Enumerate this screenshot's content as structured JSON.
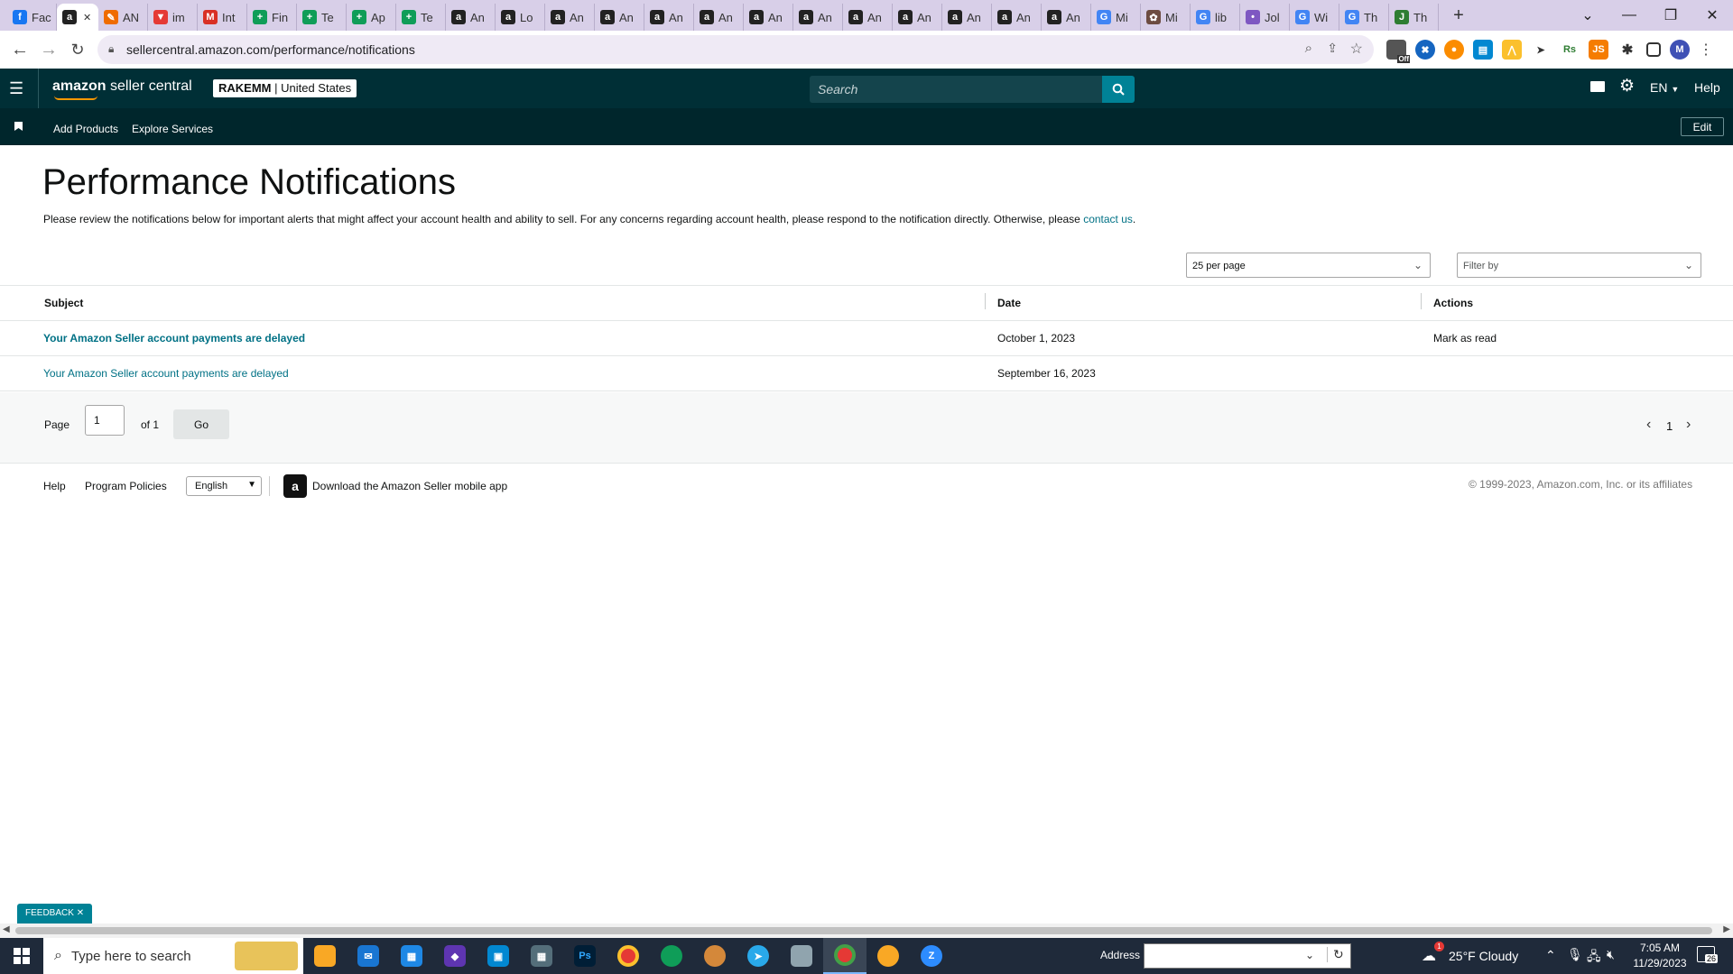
{
  "browser": {
    "tabs": [
      {
        "label": "Fac",
        "fav": "f",
        "color": "#1877f2"
      },
      {
        "label": "",
        "fav": "a",
        "color": "#222",
        "active": true
      },
      {
        "label": "AN",
        "fav": "✎",
        "color": "#ef6c00"
      },
      {
        "label": "im",
        "fav": "▼",
        "color": "#e53935"
      },
      {
        "label": "Int",
        "fav": "M",
        "color": "#d93025"
      },
      {
        "label": "Fin",
        "fav": "+",
        "color": "#0f9d58"
      },
      {
        "label": "Te",
        "fav": "+",
        "color": "#0f9d58"
      },
      {
        "label": "Ap",
        "fav": "+",
        "color": "#0f9d58"
      },
      {
        "label": "Te",
        "fav": "+",
        "color": "#0f9d58"
      },
      {
        "label": "An",
        "fav": "a",
        "color": "#222"
      },
      {
        "label": "Lo",
        "fav": "a",
        "color": "#222"
      },
      {
        "label": "An",
        "fav": "a",
        "color": "#222"
      },
      {
        "label": "An",
        "fav": "a",
        "color": "#222"
      },
      {
        "label": "An",
        "fav": "a",
        "color": "#222"
      },
      {
        "label": "An",
        "fav": "a",
        "color": "#222"
      },
      {
        "label": "An",
        "fav": "a",
        "color": "#222"
      },
      {
        "label": "An",
        "fav": "a",
        "color": "#222"
      },
      {
        "label": "An",
        "fav": "a",
        "color": "#222"
      },
      {
        "label": "An",
        "fav": "a",
        "color": "#222"
      },
      {
        "label": "An",
        "fav": "a",
        "color": "#222"
      },
      {
        "label": "An",
        "fav": "a",
        "color": "#222"
      },
      {
        "label": "An",
        "fav": "a",
        "color": "#222"
      },
      {
        "label": "Mi",
        "fav": "G",
        "color": "#4285f4"
      },
      {
        "label": "Mi",
        "fav": "✿",
        "color": "#6d4c41"
      },
      {
        "label": "lib",
        "fav": "G",
        "color": "#4285f4"
      },
      {
        "label": "Jol",
        "fav": "•",
        "color": "#7e57c2"
      },
      {
        "label": "Wi",
        "fav": "G",
        "color": "#4285f4"
      },
      {
        "label": "Th",
        "fav": "G",
        "color": "#4285f4"
      },
      {
        "label": "Th",
        "fav": "J",
        "color": "#2e7d32"
      }
    ],
    "new_tab": "+",
    "url": "sellercentral.amazon.com/performance/notifications",
    "profile_initial": "M",
    "ext_badge": "Off"
  },
  "header": {
    "logo_amazon": "amazon",
    "logo_rest": " seller central",
    "account_name": "RAKEMM",
    "account_region": " | United States",
    "search_placeholder": "Search",
    "lang": "EN",
    "help": "Help"
  },
  "subnav": {
    "items": [
      "Add Products",
      "Explore Services"
    ],
    "edit": "Edit"
  },
  "page": {
    "title": "Performance Notifications",
    "desc": "Please review the notifications below for important alerts that might affect your account health and ability to sell. For any concerns regarding account health, please respond to the notification directly. Otherwise, please ",
    "desc_link": "contact us",
    "desc_end": ".",
    "per_page": "25 per page",
    "filter": "Filter by"
  },
  "table": {
    "headers": {
      "subject": "Subject",
      "date": "Date",
      "actions": "Actions"
    },
    "rows": [
      {
        "subject": "Your Amazon Seller account payments are delayed",
        "date": "October 1, 2023",
        "action": "Mark as read",
        "unread": true
      },
      {
        "subject": "Your Amazon Seller account payments are delayed",
        "date": "September 16, 2023",
        "action": "",
        "unread": false
      }
    ]
  },
  "pagination": {
    "page_label": "Page",
    "page_value": "1",
    "of_label": "of 1",
    "go": "Go",
    "current": "1"
  },
  "footer": {
    "help": "Help",
    "policies": "Program Policies",
    "language": "English",
    "app": "Download the Amazon Seller mobile app",
    "copyright": "© 1999-2023, Amazon.com, Inc. or its affiliates"
  },
  "feedback": "FEEDBACK",
  "taskbar": {
    "search_placeholder": "Type here to search",
    "address_label": "Address",
    "weather": "25°F  Cloudy",
    "weather_badge": "1",
    "time": "7:05 AM",
    "date": "11/29/2023",
    "notif_count": "26"
  }
}
